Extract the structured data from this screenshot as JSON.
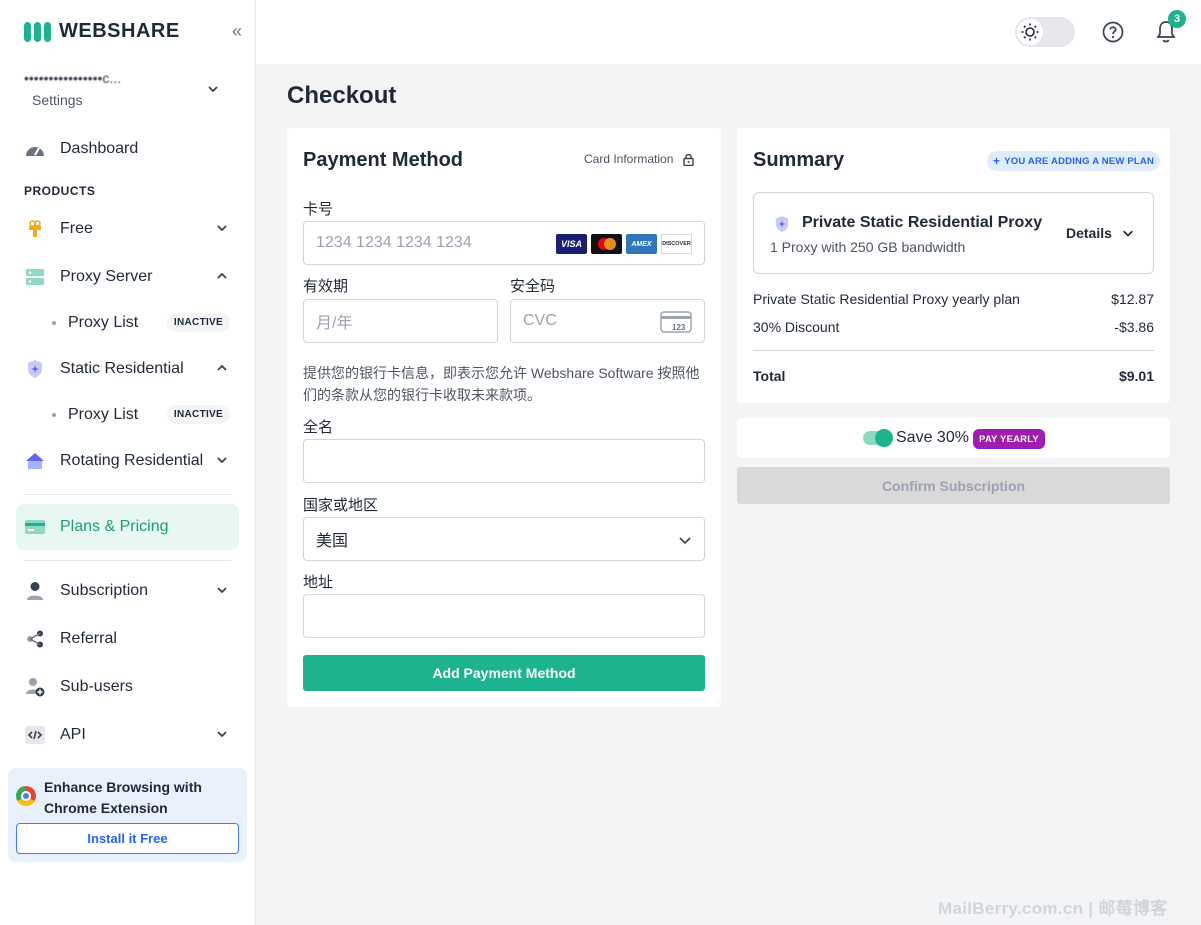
{
  "brand": {
    "name": "WEBSHARE"
  },
  "account": {
    "email": "••••••••••••••••c...",
    "settings_label": "Settings"
  },
  "sidebar": {
    "dashboard": "Dashboard",
    "products_heading": "PRODUCTS",
    "free": "Free",
    "proxy_server": "Proxy Server",
    "proxy_server_sub": {
      "label": "Proxy List",
      "badge": "INACTIVE"
    },
    "static_residential": "Static Residential",
    "static_residential_sub": {
      "label": "Proxy List",
      "badge": "INACTIVE"
    },
    "rotating_residential": "Rotating Residential",
    "plans_pricing": "Plans & Pricing",
    "subscription": "Subscription",
    "referral": "Referral",
    "sub_users": "Sub-users",
    "api": "API"
  },
  "extension": {
    "text": "Enhance Browsing with Chrome Extension",
    "button": "Install it Free"
  },
  "topbar": {
    "notification_count": "3"
  },
  "page": {
    "title": "Checkout"
  },
  "payment": {
    "title": "Payment Method",
    "card_info_label": "Card Information",
    "card_number_label": "卡号",
    "card_number_placeholder": "1234 1234 1234 1234",
    "expiry_label": "有效期",
    "expiry_placeholder": "月/年",
    "cvc_label": "安全码",
    "cvc_placeholder": "CVC",
    "disclaimer": "提供您的银行卡信息，即表示您允许 Webshare Software 按照他们的条款从您的银行卡收取未来款项。",
    "full_name_label": "全名",
    "country_label": "国家或地区",
    "country_value": "美国",
    "address_label": "地址",
    "submit": "Add Payment Method",
    "card_brands": [
      "VISA",
      "mastercard",
      "AMEX",
      "DISCOVER"
    ]
  },
  "summary": {
    "title": "Summary",
    "new_plan_badge": "YOU ARE ADDING A NEW PLAN",
    "plan_name": "Private Static Residential Proxy",
    "plan_desc": "1 Proxy with 250 GB bandwidth",
    "details_label": "Details",
    "lines": [
      {
        "label": "Private Static Residential Proxy yearly plan",
        "value": "$12.87"
      },
      {
        "label": "30% Discount",
        "value": "-$3.86"
      }
    ],
    "total_label": "Total",
    "total_value": "$9.01",
    "save_text": "Save 30%",
    "pay_yearly": "PAY YEARLY",
    "confirm": "Confirm Subscription"
  },
  "watermark": "MailBerry.com.cn | 邮莓博客",
  "colors": {
    "accent": "#1db38f",
    "active_bg": "#e8f7f2",
    "link_blue": "#2563eb",
    "badge_purple": "#a21caf"
  }
}
